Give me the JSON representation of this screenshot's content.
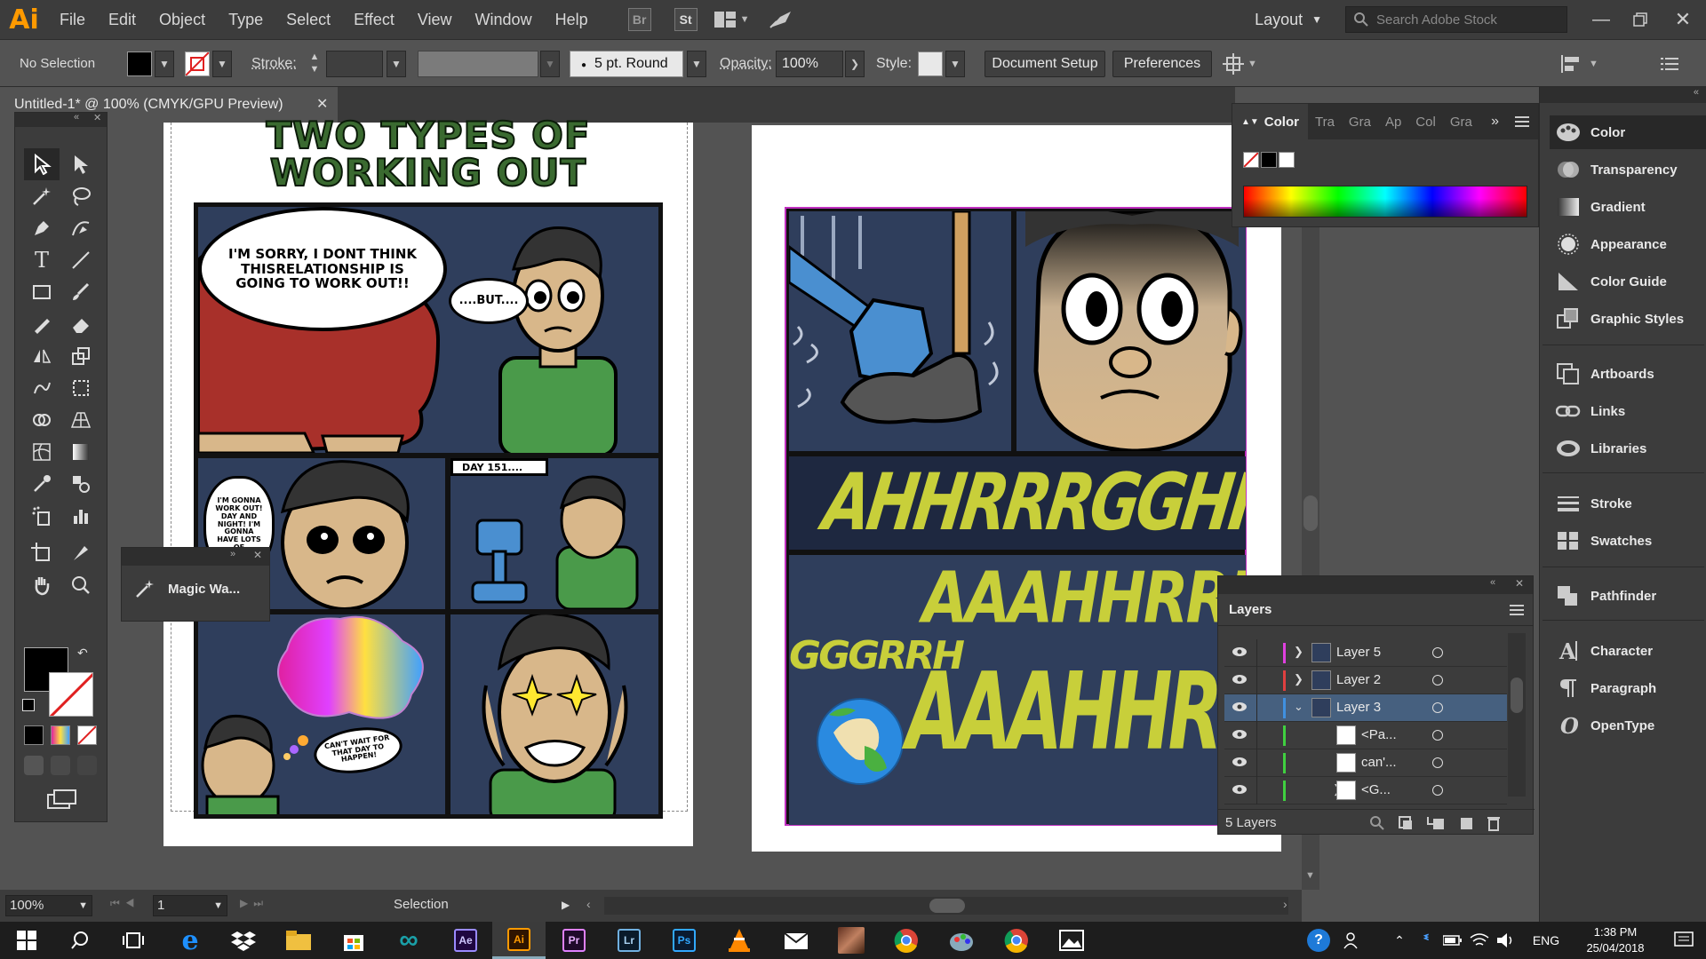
{
  "app": {
    "logo": "Ai"
  },
  "menu": [
    "File",
    "Edit",
    "Object",
    "Type",
    "Select",
    "Effect",
    "View",
    "Window",
    "Help"
  ],
  "topbar": {
    "bridge": "Br",
    "stock": "St",
    "workspace": "Layout",
    "search_placeholder": "Search Adobe Stock"
  },
  "control": {
    "selection": "No Selection",
    "stroke_label": "Stroke:",
    "brush": "5 pt. Round",
    "opacity_label": "Opacity:",
    "opacity_value": "100%",
    "style_label": "Style:",
    "doc_setup": "Document Setup",
    "preferences": "Preferences"
  },
  "doc_tab": {
    "title": "Untitled-1* @ 100% (CMYK/GPU Preview)"
  },
  "comic": {
    "title_line1": "TWO TYPES OF",
    "title_line2": "WORKING OUT",
    "speech1": "I'M SORRY, I DONT THINK THISRELATIONSHIP IS GOING TO WORK OUT!!",
    "speech2": "....BUT....",
    "speech3": "I'M GONNA WORK OUT! DAY AND NIGHT! I'M GONNA HAVE LOTS OF",
    "caption": "DAY 151....",
    "thought": "CAN'T WAIT FOR THAT DAY TO HAPPEN!",
    "sfx1": "AHHRRRGGHHH!!!!!",
    "sfx2": "AAAHHRRRGG",
    "sfx3": "GGGRRH",
    "sfx4": "AAAHHRRRGGGRRR"
  },
  "magic_wand": {
    "label": "Magic Wa..."
  },
  "color_panel": {
    "tabs": [
      "Color",
      "Tra",
      "Gra",
      "Ap",
      "Col",
      "Gra"
    ]
  },
  "right_panels": [
    {
      "label": "Color",
      "icon": "color-palette-icon"
    },
    {
      "label": "Transparency",
      "icon": "transparency-icon"
    },
    {
      "label": "Gradient",
      "icon": "gradient-icon"
    },
    {
      "label": "Appearance",
      "icon": "appearance-icon"
    },
    {
      "label": "Color Guide",
      "icon": "color-guide-icon"
    },
    {
      "label": "Graphic Styles",
      "icon": "graphic-styles-icon"
    },
    {
      "label": "Artboards",
      "icon": "artboards-icon"
    },
    {
      "label": "Links",
      "icon": "links-icon"
    },
    {
      "label": "Libraries",
      "icon": "libraries-icon"
    },
    {
      "label": "Stroke",
      "icon": "stroke-icon"
    },
    {
      "label": "Swatches",
      "icon": "swatches-icon"
    },
    {
      "label": "Pathfinder",
      "icon": "pathfinder-icon"
    },
    {
      "label": "Character",
      "icon": "character-icon"
    },
    {
      "label": "Paragraph",
      "icon": "paragraph-icon"
    },
    {
      "label": "OpenType",
      "icon": "opentype-icon"
    }
  ],
  "layers": {
    "title": "Layers",
    "rows": [
      "Layer 5",
      "Layer 2",
      "Layer 3",
      "<Pa...",
      "can'...",
      "<G..."
    ],
    "count": "5 Layers"
  },
  "status": {
    "zoom": "100%",
    "artboard": "1",
    "tool": "Selection"
  },
  "taskbar": {
    "lang": "ENG",
    "time": "1:38 PM",
    "date": "25/04/2018"
  },
  "colors": {
    "accent": "#ff9a00",
    "layer_selected": "#46607f",
    "panel_bg": "#535353"
  }
}
